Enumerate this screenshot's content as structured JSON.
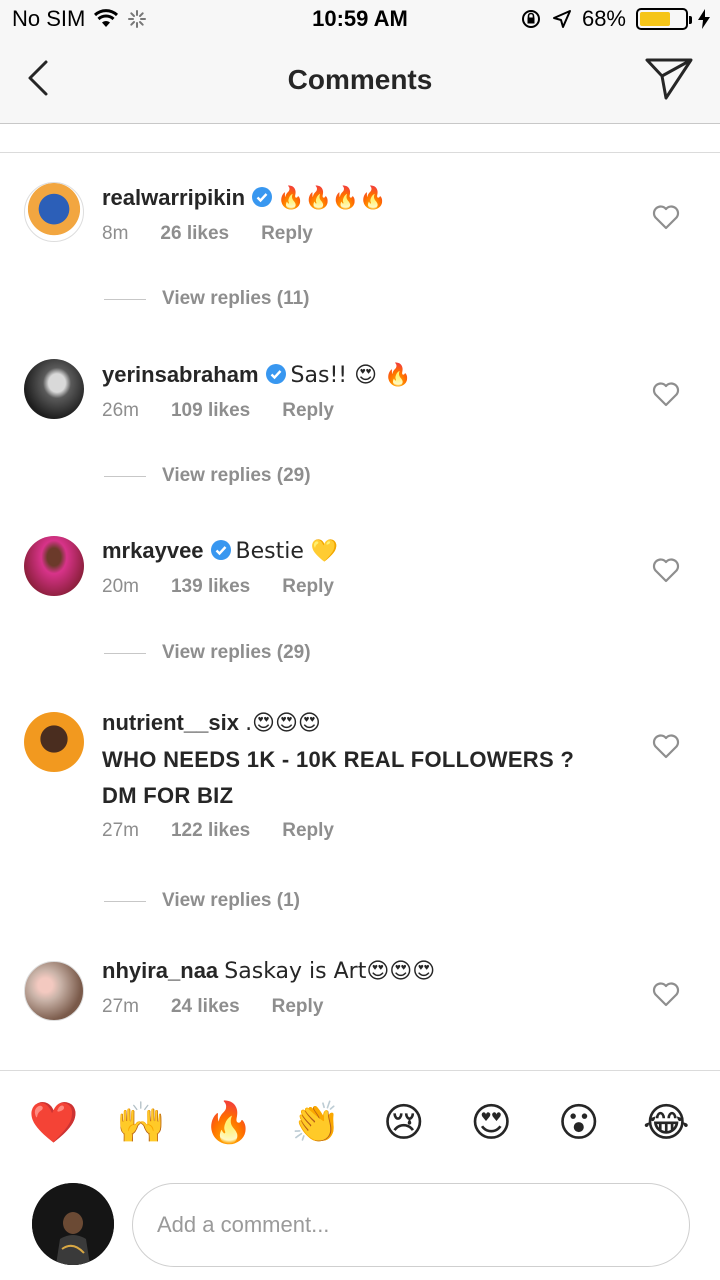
{
  "status_bar": {
    "carrier": "No SIM",
    "time": "10:59 AM",
    "battery": "68%",
    "battery_level": 0.68
  },
  "nav": {
    "title": "Comments"
  },
  "comments": [
    {
      "username": "realwarripikin",
      "verified": true,
      "text": "🔥🔥🔥🔥",
      "text2": "",
      "time": "8m",
      "likes": "26 likes",
      "reply": "Reply",
      "view_replies": "View replies (11)"
    },
    {
      "username": "yerinsabraham",
      "verified": true,
      "text": "Sas!! 😍 🔥",
      "text2": "",
      "time": "26m",
      "likes": "109 likes",
      "reply": "Reply",
      "view_replies": "View replies (29)"
    },
    {
      "username": "mrkayvee",
      "verified": true,
      "text": "Bestie 💛",
      "text2": "",
      "time": "20m",
      "likes": "139 likes",
      "reply": "Reply",
      "view_replies": "View replies (29)"
    },
    {
      "username": "nutrient__six",
      "verified": false,
      "text": ".😍😍😍",
      "text2": "WHO NEEDS 1K - 10K REAL FOLLOWERS ? DM FOR BIZ",
      "time": "27m",
      "likes": "122 likes",
      "reply": "Reply",
      "view_replies": "View replies (1)"
    },
    {
      "username": "nhyira_naa",
      "verified": false,
      "text": "Saskay is Art😍😍😍",
      "text2": "",
      "time": "27m",
      "likes": "24 likes",
      "reply": "Reply",
      "view_replies": ""
    }
  ],
  "quick_emojis": [
    "❤️",
    "🙌",
    "🔥",
    "👏",
    "😢",
    "😍",
    "😮",
    "😂"
  ],
  "composer": {
    "placeholder": "Add a comment..."
  },
  "colors": {
    "verified_blue": "#3897f0",
    "meta_gray": "#8e8e8e",
    "battery_yellow": "#f5c518"
  }
}
